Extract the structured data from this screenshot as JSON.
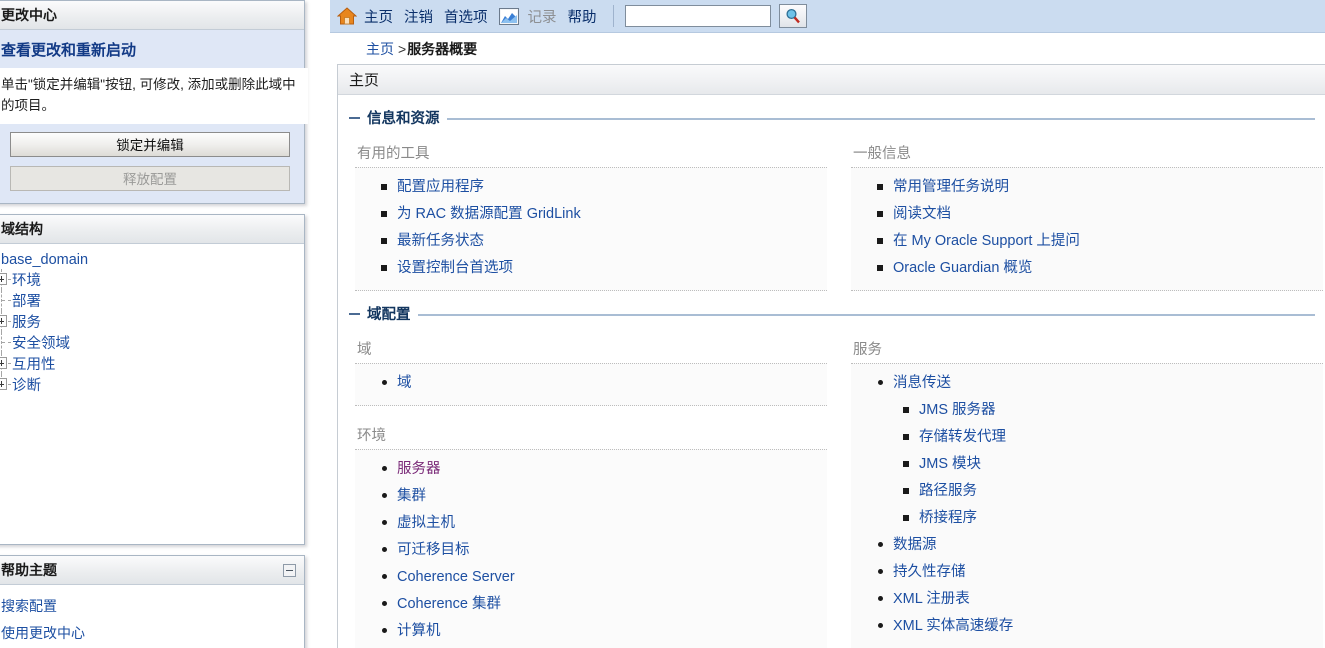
{
  "colors": {
    "nav_bar": "#cbdcf0",
    "link": "#1d4fa2",
    "visited_link": "#7a2a78",
    "section_title": "#13365f",
    "group_title": "#8a8a8a",
    "change_center_accent": "#dfe7f6",
    "home_icon": "#e8861e"
  },
  "change_center": {
    "header": "更改中心",
    "subtitle": "查看更改和重新启动",
    "description": "单击\"锁定并编辑\"按钮, 可修改, 添加或删除此域中的项目。",
    "lock_and_edit_label": "锁定并编辑",
    "release_configuration_label": "释放配置"
  },
  "domain_structure": {
    "header": "域结构",
    "root": "base_domain",
    "nodes": [
      {
        "label": "环境",
        "expandable": true
      },
      {
        "label": "部署",
        "expandable": false
      },
      {
        "label": "服务",
        "expandable": true
      },
      {
        "label": "安全领域",
        "expandable": false
      },
      {
        "label": "互用性",
        "expandable": true
      },
      {
        "label": "诊断",
        "expandable": true
      }
    ]
  },
  "help_topics": {
    "header": "帮助主题",
    "items": [
      {
        "label": "搜索配置"
      },
      {
        "label": "使用更改中心"
      }
    ]
  },
  "topnav": {
    "home_icon": "home-icon",
    "links": [
      {
        "label": "主页",
        "disabled": false
      },
      {
        "label": "注销",
        "disabled": false
      },
      {
        "label": "首选项",
        "disabled": false
      }
    ],
    "chart_icon": "chart-image-icon",
    "links_after_icon": [
      {
        "label": "记录",
        "disabled": true
      },
      {
        "label": "帮助",
        "disabled": false
      }
    ],
    "search": {
      "value": "",
      "placeholder": ""
    },
    "search_button_icon": "search-magnifier-icon"
  },
  "breadcrumb": {
    "home": "主页",
    "separator": ">",
    "current": "服务器概要"
  },
  "page": {
    "title": "主页"
  },
  "sections": [
    {
      "title": "信息和资源",
      "groups": [
        {
          "title": "有用的工具",
          "bullet": "square",
          "shaded": false,
          "items": [
            {
              "label": "配置应用程序",
              "visited": false
            },
            {
              "label": "为 RAC 数据源配置 GridLink",
              "visited": false
            },
            {
              "label": "最新任务状态",
              "visited": false
            },
            {
              "label": "设置控制台首选项",
              "visited": false
            }
          ]
        },
        {
          "title": "一般信息",
          "bullet": "square",
          "shaded": true,
          "items": [
            {
              "label": "常用管理任务说明",
              "visited": false
            },
            {
              "label": "阅读文档",
              "visited": false
            },
            {
              "label": "在 My Oracle Support 上提问",
              "visited": false
            },
            {
              "label": "Oracle Guardian 概览",
              "visited": false
            }
          ]
        }
      ]
    },
    {
      "title": "域配置",
      "groups": [
        {
          "title": "域",
          "bullet": "round",
          "shaded": false,
          "items": [
            {
              "label": "域",
              "visited": false
            }
          ]
        },
        {
          "title": "服务",
          "bullet": "round",
          "shaded": true,
          "items": [
            {
              "label": "消息传送",
              "visited": false,
              "children": [
                {
                  "label": "JMS 服务器"
                },
                {
                  "label": "存储转发代理"
                },
                {
                  "label": "JMS 模块"
                },
                {
                  "label": "路径服务"
                },
                {
                  "label": "桥接程序"
                }
              ]
            },
            {
              "label": "数据源",
              "visited": false
            },
            {
              "label": "持久性存储",
              "visited": false
            },
            {
              "label": "XML 注册表",
              "visited": false
            },
            {
              "label": "XML 实体高速缓存",
              "visited": false
            }
          ]
        },
        {
          "title": "环境",
          "bullet": "round",
          "shaded": false,
          "items": [
            {
              "label": "服务器",
              "visited": true
            },
            {
              "label": "集群",
              "visited": false
            },
            {
              "label": "虚拟主机",
              "visited": false
            },
            {
              "label": "可迁移目标",
              "visited": false
            },
            {
              "label": "Coherence Server",
              "visited": false
            },
            {
              "label": "Coherence 集群",
              "visited": false
            },
            {
              "label": "计算机",
              "visited": false
            }
          ]
        }
      ]
    }
  ]
}
